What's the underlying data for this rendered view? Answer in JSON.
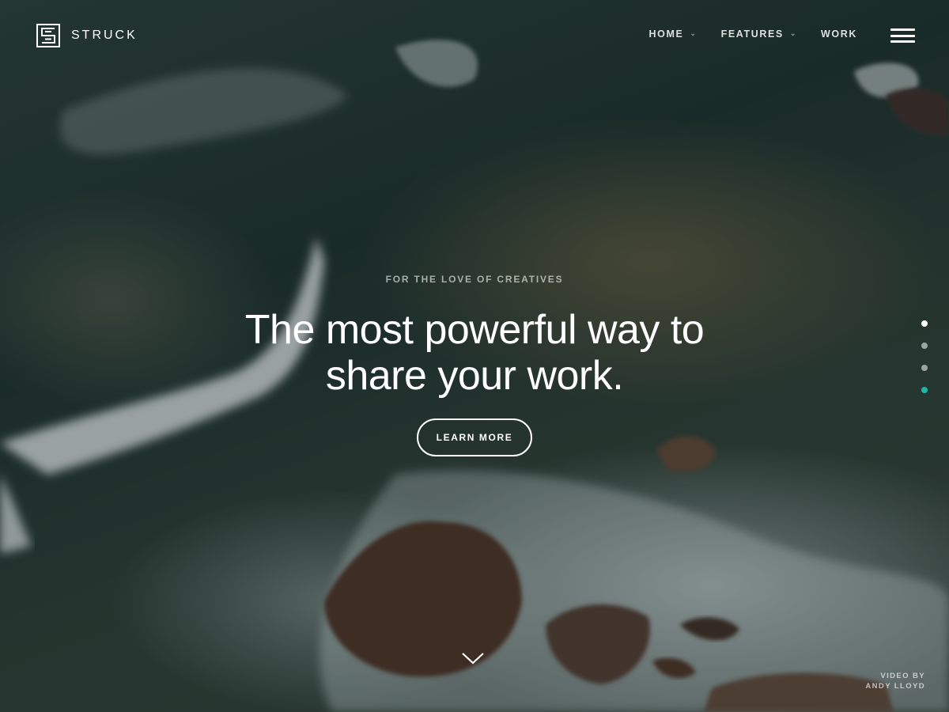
{
  "brand": {
    "name": "STRUCK",
    "logo_icon": "struck-logo-icon"
  },
  "nav": {
    "items": [
      {
        "label": "HOME",
        "has_dropdown": true
      },
      {
        "label": "FEATURES",
        "has_dropdown": true
      },
      {
        "label": "WORK",
        "has_dropdown": false
      }
    ],
    "menu_icon": "hamburger-menu-icon"
  },
  "hero": {
    "eyebrow": "FOR THE LOVE OF CREATIVES",
    "headline_line1": "The most powerful way to",
    "headline_line2": "share your work.",
    "cta_label": "LEARN MORE",
    "background": "aerial ocean waves video"
  },
  "slider": {
    "dot_count": 4,
    "active_index": 0,
    "accent_color": "#1fb5ad"
  },
  "scroll_icon": "chevron-down-icon",
  "credit": {
    "line1": "VIDEO BY",
    "line2": "ANDY LLOYD"
  }
}
